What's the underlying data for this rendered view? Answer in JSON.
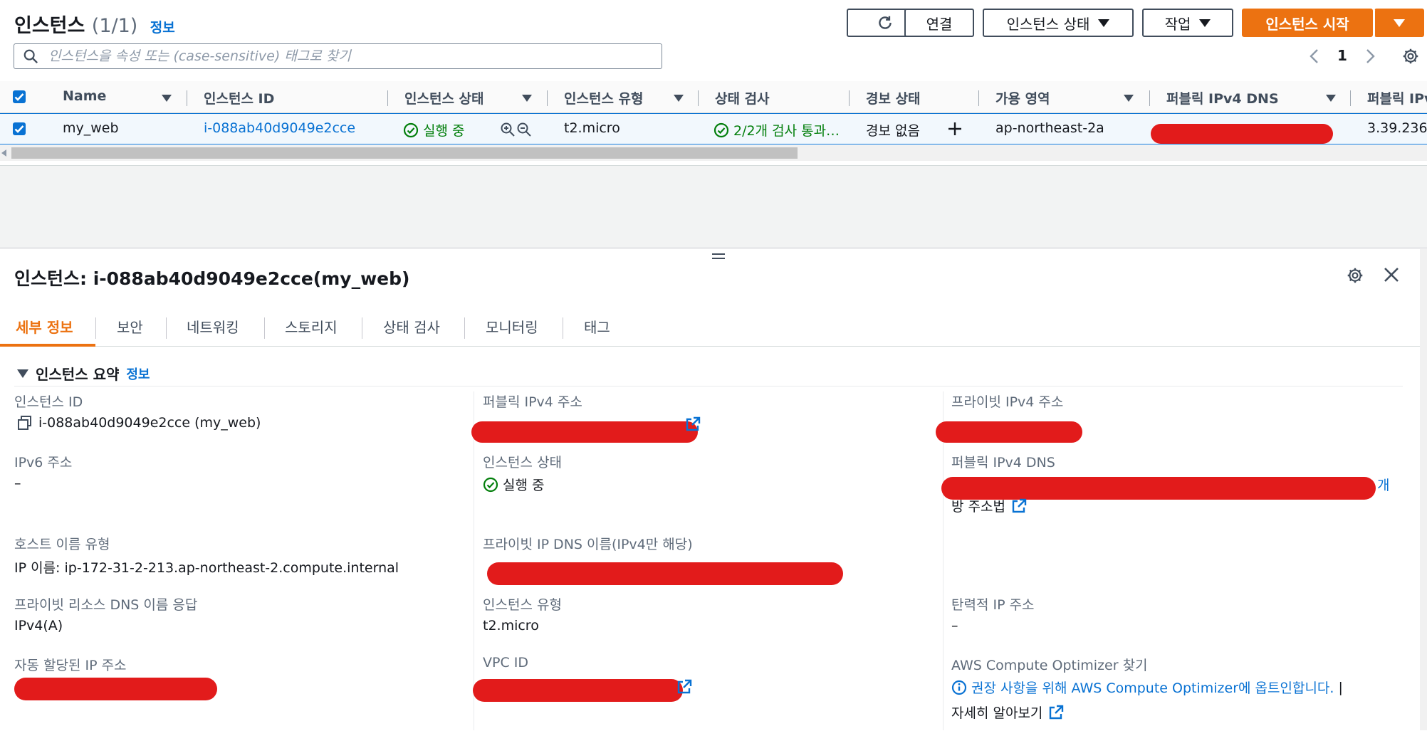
{
  "header": {
    "title": "인스턴스",
    "count": "(1/1)",
    "info_link": "정보",
    "refresh_icon": "refresh-icon",
    "connect_button": "연결",
    "instance_state_button": "인스턴스 상태",
    "actions_button": "작업",
    "start_button": "인스턴스 시작",
    "search_placeholder": "인스턴스을 속성 또는 (case-sensitive) 태그로 찾기",
    "page_number": "1"
  },
  "table": {
    "columns": [
      "Name",
      "인스턴스 ID",
      "인스턴스 상태",
      "인스턴스 유형",
      "상태 검사",
      "경보 상태",
      "가용 영역",
      "퍼블릭 IPv4 DNS",
      "퍼블릭 IPv"
    ],
    "row": {
      "name": "my_web",
      "instance_id": "i-088ab40d9049e2cce",
      "state": "실행 중",
      "type": "t2.micro",
      "status_check": "2/2개 검사 통과…",
      "alarm": "경보 없음",
      "az": "ap-northeast-2a",
      "public_ip": "3.39.236."
    }
  },
  "detail": {
    "title": "인스턴스: i-088ab40d9049e2cce(my_web)",
    "tabs": [
      "세부 정보",
      "보안",
      "네트워킹",
      "스토리지",
      "상태 검사",
      "모니터링",
      "태그"
    ],
    "section_title": "인스턴스 요약",
    "section_info": "정보",
    "fields": {
      "instance_id_label": "인스턴스 ID",
      "instance_id_value": "i-088ab40d9049e2cce (my_web)",
      "public_ipv4_label": "퍼블릭 IPv4 주소",
      "private_ipv4_label": "프라이빗 IPv4 주소",
      "ipv6_label": "IPv6 주소",
      "ipv6_value": "–",
      "instance_state_label": "인스턴스 상태",
      "instance_state_value": "실행 중",
      "public_dns_label": "퍼블릭 IPv4 DNS",
      "public_dns_tail_1": "개",
      "public_dns_tail_2": "방 주소법",
      "hostname_type_label": "호스트 이름 유형",
      "hostname_type_value": "IP 이름: ip-172-31-2-213.ap-northeast-2.compute.internal",
      "private_dns_label": "프라이빗 IP DNS 이름(IPv4만 해당)",
      "private_resource_dns_label": "프라이빗 리소스 DNS 이름 응답",
      "private_resource_dns_value": "IPv4(A)",
      "instance_type_label": "인스턴스 유형",
      "instance_type_value": "t2.micro",
      "elastic_ip_label": "탄력적 IP 주소",
      "elastic_ip_value": "–",
      "auto_ip_label": "자동 할당된 IP 주소",
      "vpc_label": "VPC ID",
      "optimizer_label": "AWS Compute Optimizer 찾기",
      "optimizer_text": "권장 사항을 위해 AWS Compute Optimizer에 옵트인합니다.",
      "optimizer_sep": "|",
      "learn_more": "자세히 알아보기"
    }
  },
  "colors": {
    "primary": "#ec7211",
    "link": "#0972d3",
    "success": "#037f0c",
    "redaction": "#e21b1b"
  }
}
